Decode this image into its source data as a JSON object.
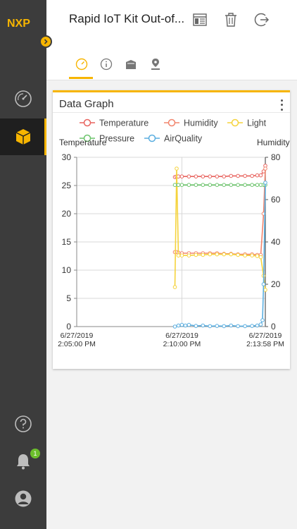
{
  "app": {
    "logo_text": "NXP",
    "title": "Rapid IoT Kit Out-of...",
    "notifications_count": "1",
    "colors": {
      "accent": "#f7b500",
      "sidebar": "#3c3c3c",
      "badge": "#6cbf2c"
    }
  },
  "header": {
    "icons": [
      "report-icon",
      "trash-icon",
      "logout-icon"
    ],
    "tabs": [
      "dashboard-gauge-icon",
      "info-icon",
      "device-icon",
      "location-pin-icon"
    ],
    "active_tab": 0
  },
  "sidebar": {
    "items": [
      "dashboard-gauge-icon",
      "device-cube-icon"
    ],
    "active_item": 1,
    "bottom_items": [
      "help-icon",
      "bell-icon",
      "account-icon"
    ]
  },
  "card": {
    "title": "Data Graph"
  },
  "chart_data": {
    "type": "line",
    "legend": [
      "Temperature",
      "Humidity",
      "Light",
      "Pressure",
      "AirQuality"
    ],
    "left_axis_label": "Temperature",
    "right_axis_label": "Humidity",
    "left_ticks": [
      "0",
      "5",
      "10",
      "15",
      "20",
      "25",
      "30"
    ],
    "right_ticks": [
      "0",
      "20",
      "40",
      "60",
      "80"
    ],
    "left_ylim": [
      0,
      30
    ],
    "right_ylim": [
      0,
      80
    ],
    "x_ticks": [
      {
        "date": "6/27/2019",
        "time": "2:05:00 PM"
      },
      {
        "date": "6/27/2019",
        "time": "2:10:00 PM"
      },
      {
        "date": "6/27/2019",
        "time": "2:13:58 PM"
      }
    ],
    "x_seconds_ticks": [
      0,
      300,
      538
    ],
    "grid": true,
    "legend_placement": "top",
    "series": [
      {
        "name": "Temperature",
        "axis": "left",
        "color": "#e8635e",
        "x": [
          280,
          285,
          290,
          300,
          320,
          340,
          360,
          380,
          400,
          420,
          440,
          460,
          480,
          500,
          515,
          525,
          533,
          538
        ],
        "y": [
          26.5,
          26.6,
          26.6,
          26.6,
          26.6,
          26.6,
          26.6,
          26.6,
          26.6,
          26.6,
          26.7,
          26.7,
          26.7,
          26.7,
          26.8,
          26.8,
          27.5,
          28.5
        ]
      },
      {
        "name": "Humidity",
        "axis": "left",
        "color": "#f2856d",
        "x": [
          280,
          285,
          290,
          300,
          320,
          340,
          360,
          380,
          400,
          420,
          440,
          460,
          480,
          500,
          515,
          525,
          533,
          538
        ],
        "y": [
          13.2,
          13.2,
          13.1,
          13.0,
          13.0,
          13.0,
          13.0,
          13.0,
          13.0,
          12.9,
          12.9,
          12.8,
          12.8,
          12.8,
          12.7,
          12.7,
          20.0,
          28.0
        ]
      },
      {
        "name": "Light",
        "axis": "left",
        "color": "#f5d33c",
        "x": [
          280,
          285,
          290,
          300,
          320,
          340,
          360,
          380,
          400,
          420,
          440,
          460,
          480,
          500,
          515,
          525,
          533,
          538
        ],
        "y": [
          7.0,
          28.0,
          12.6,
          12.6,
          12.6,
          12.7,
          12.7,
          12.8,
          12.8,
          12.8,
          12.8,
          12.7,
          12.6,
          12.6,
          12.5,
          12.3,
          9.0,
          6.5
        ]
      },
      {
        "name": "Pressure",
        "axis": "left",
        "color": "#6cc46c",
        "x": [
          280,
          290,
          300,
          320,
          340,
          360,
          380,
          400,
          420,
          440,
          460,
          480,
          500,
          515,
          525,
          533,
          538
        ],
        "y": [
          25.1,
          25.1,
          25.1,
          25.1,
          25.1,
          25.1,
          25.1,
          25.1,
          25.1,
          25.1,
          25.1,
          25.1,
          25.1,
          25.1,
          25.1,
          25.1,
          25.1
        ]
      },
      {
        "name": "AirQuality",
        "axis": "right",
        "color": "#5aaee0",
        "x": [
          280,
          290,
          300,
          310,
          320,
          340,
          360,
          380,
          400,
          420,
          440,
          460,
          480,
          500,
          515,
          525,
          530,
          533,
          538
        ],
        "y": [
          0,
          0.5,
          0.8,
          0.5,
          0.8,
          0.3,
          0.5,
          0.2,
          0.3,
          0.2,
          0.5,
          0.2,
          0.2,
          0.3,
          0.5,
          1.0,
          3,
          20,
          68
        ]
      }
    ]
  }
}
